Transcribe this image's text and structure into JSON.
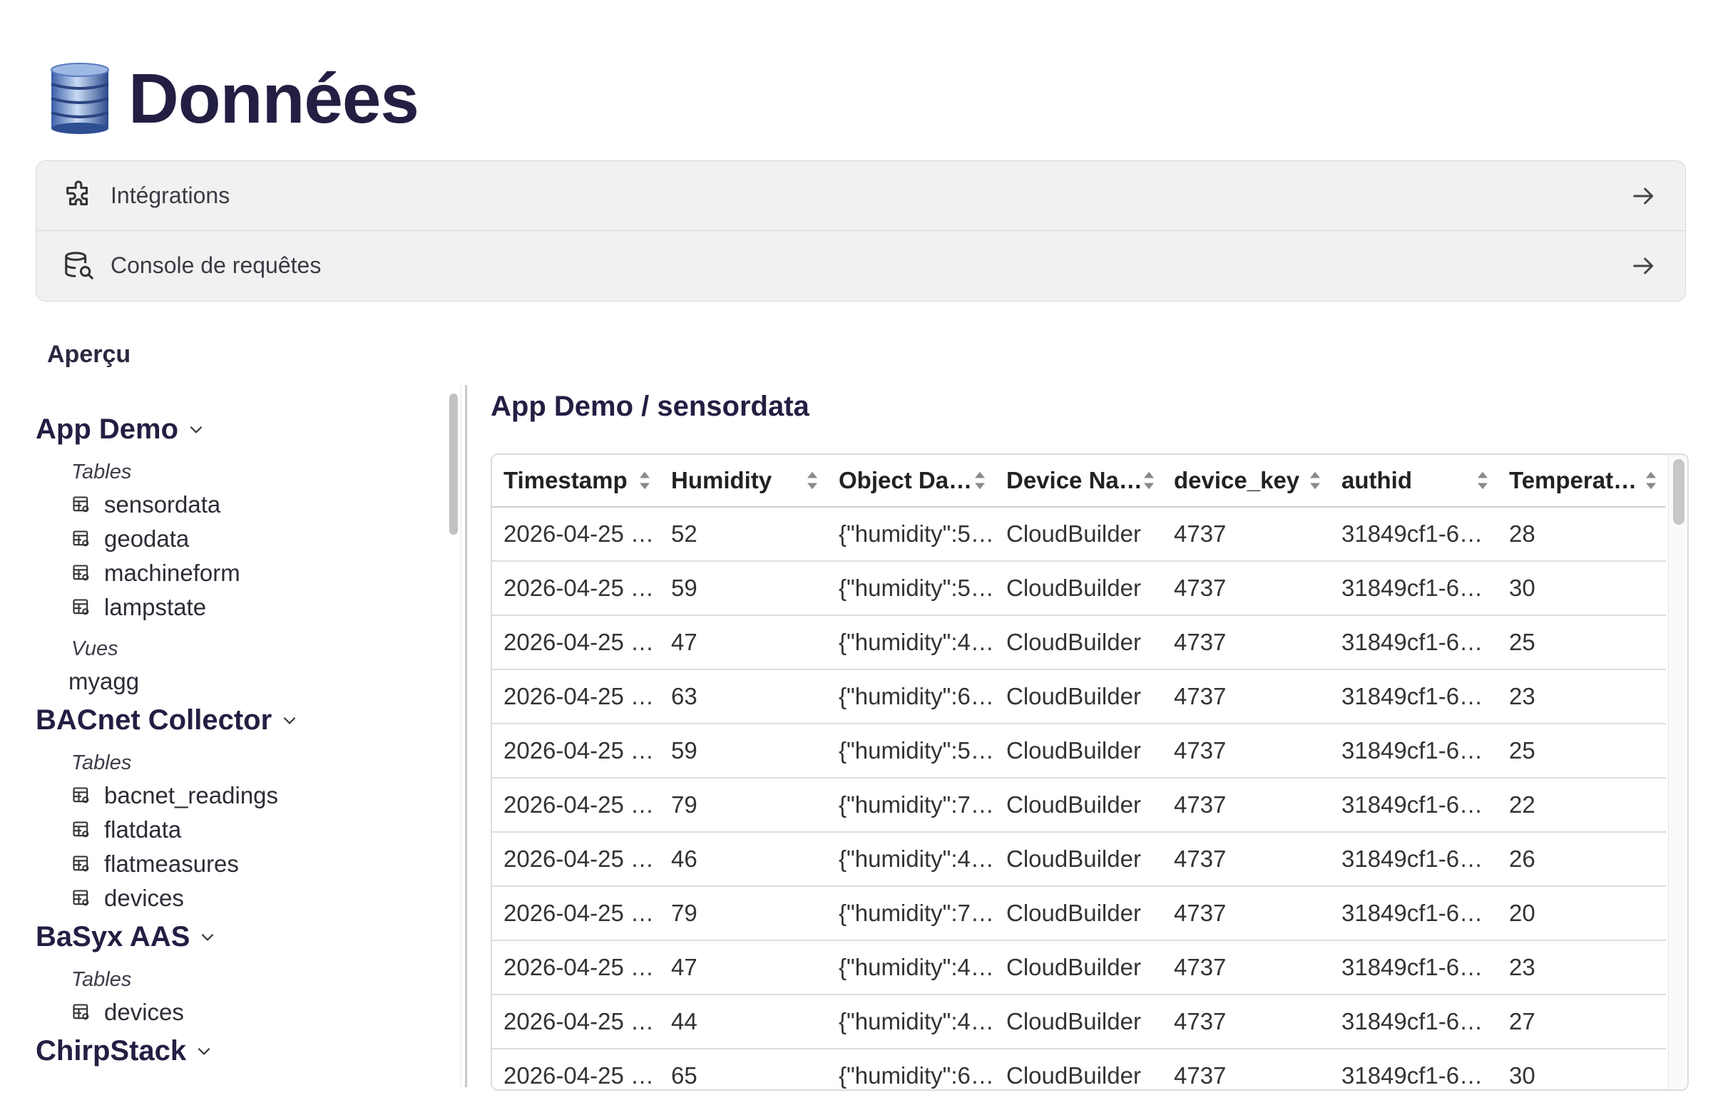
{
  "page": {
    "title": "Données",
    "icon": "database-icon"
  },
  "links": [
    {
      "label": "Intégrations",
      "icon": "puzzle-icon"
    },
    {
      "label": "Console de requêtes",
      "icon": "query-console-icon"
    }
  ],
  "overview_label": "Aperçu",
  "sidebar": {
    "groups": [
      {
        "name": "App Demo",
        "tables_label": "Tables",
        "tables": [
          "sensordata",
          "geodata",
          "machineform",
          "lampstate"
        ],
        "views_label": "Vues",
        "views": [
          "myagg"
        ]
      },
      {
        "name": "BACnet Collector",
        "tables_label": "Tables",
        "tables": [
          "bacnet_readings",
          "flatdata",
          "flatmeasures",
          "devices"
        ]
      },
      {
        "name": "BaSyx AAS",
        "tables_label": "Tables",
        "tables": [
          "devices"
        ]
      },
      {
        "name": "ChirpStack"
      }
    ]
  },
  "panel": {
    "title": "App Demo / sensordata",
    "columns": [
      "Timestamp",
      "Humidity",
      "Object Da…",
      "Device Na…",
      "device_key",
      "authid",
      "Temperat…"
    ],
    "rows": [
      [
        "2026-04-25 …",
        "52",
        "{\"humidity\":5…",
        "CloudBuilder",
        "4737",
        "31849cf1-6…",
        "28"
      ],
      [
        "2026-04-25 …",
        "59",
        "{\"humidity\":5…",
        "CloudBuilder",
        "4737",
        "31849cf1-6…",
        "30"
      ],
      [
        "2026-04-25 …",
        "47",
        "{\"humidity\":4…",
        "CloudBuilder",
        "4737",
        "31849cf1-6…",
        "25"
      ],
      [
        "2026-04-25 …",
        "63",
        "{\"humidity\":6…",
        "CloudBuilder",
        "4737",
        "31849cf1-6…",
        "23"
      ],
      [
        "2026-04-25 …",
        "59",
        "{\"humidity\":5…",
        "CloudBuilder",
        "4737",
        "31849cf1-6…",
        "25"
      ],
      [
        "2026-04-25 …",
        "79",
        "{\"humidity\":7…",
        "CloudBuilder",
        "4737",
        "31849cf1-6…",
        "22"
      ],
      [
        "2026-04-25 …",
        "46",
        "{\"humidity\":4…",
        "CloudBuilder",
        "4737",
        "31849cf1-6…",
        "26"
      ],
      [
        "2026-04-25 …",
        "79",
        "{\"humidity\":7…",
        "CloudBuilder",
        "4737",
        "31849cf1-6…",
        "20"
      ],
      [
        "2026-04-25 …",
        "47",
        "{\"humidity\":4…",
        "CloudBuilder",
        "4737",
        "31849cf1-6…",
        "23"
      ],
      [
        "2026-04-25 …",
        "44",
        "{\"humidity\":4…",
        "CloudBuilder",
        "4737",
        "31849cf1-6…",
        "27"
      ],
      [
        "2026-04-25 …",
        "65",
        "{\"humidity\":6…",
        "CloudBuilder",
        "4737",
        "31849cf1-6…",
        "30"
      ]
    ]
  },
  "colors": {
    "heading": "#221f43",
    "link_bg": "#f1f1f1",
    "border": "#dcdcdc"
  }
}
